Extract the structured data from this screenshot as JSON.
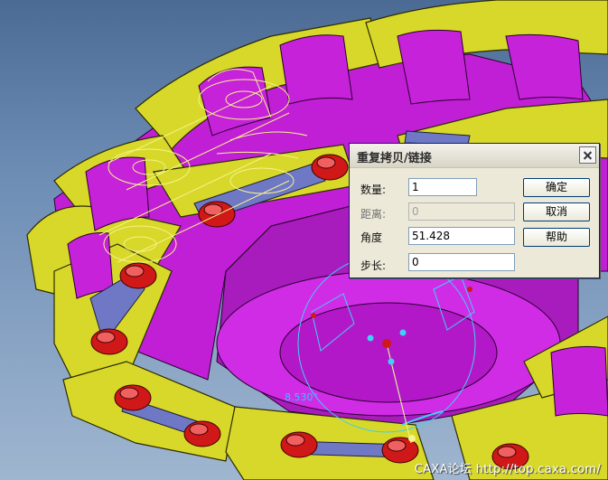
{
  "dialog": {
    "title": "重复拷贝/链接",
    "fields": {
      "count": {
        "label": "数量:",
        "value": "1"
      },
      "distance": {
        "label": "距离:",
        "value": "0"
      },
      "angle": {
        "label": "角度",
        "value": "51.428"
      },
      "step": {
        "label": "步长:",
        "value": "0"
      }
    },
    "buttons": {
      "ok": "确定",
      "cancel": "取消",
      "help": "帮助"
    }
  },
  "viewport": {
    "dimension_label": "8.530°",
    "watermark": "CAXA论坛 http://top.caxa.com/"
  },
  "colors": {
    "link_plate": "#d8d82a",
    "sprocket": "#c11fd6",
    "pin": "#d01818",
    "inner_plate": "#6f78c4",
    "wireframe": "#f4f48a",
    "construction": "#3fd0f5"
  }
}
